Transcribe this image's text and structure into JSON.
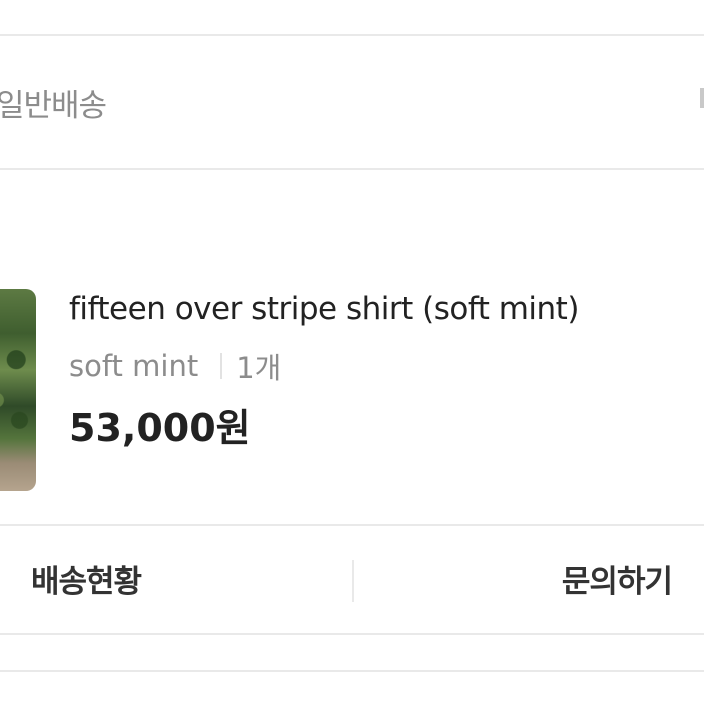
{
  "shipping": {
    "method": "일반배송"
  },
  "product": {
    "name": "fifteen over stripe shirt (soft mint)",
    "option": "soft mint",
    "quantity": "1개",
    "price": "53,000원",
    "thumbnail_icon": "product-photo"
  },
  "actions": {
    "tracking_label": "배송현황",
    "inquiry_label": "문의하기"
  },
  "colors": {
    "text_primary": "#222222",
    "text_secondary": "#8c8c8c",
    "divider": "#e9e9e9"
  }
}
